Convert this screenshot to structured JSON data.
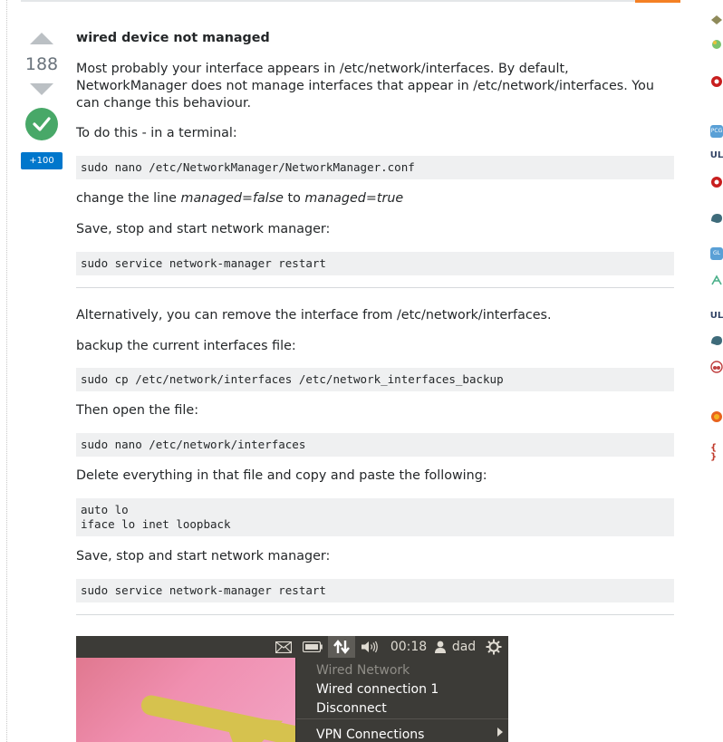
{
  "answer": {
    "vote_count": "188",
    "bounty": "+100",
    "heading": "wired device not managed",
    "p1": "Most probably your interface appears in /etc/network/interfaces. By default, NetworkManager does not manage interfaces that appear in /etc/network/interfaces. You can change this behaviour.",
    "p2": "To do this - in a terminal:",
    "code1": "sudo nano /etc/NetworkManager/NetworkManager.conf",
    "p3_pre": "change the line ",
    "p3_em1": "managed=false",
    "p3_mid": " to ",
    "p3_em2": "managed=true",
    "p4": "Save, stop and start network manager:",
    "code2": "sudo service network-manager restart",
    "p5": "Alternatively, you can remove the interface from /etc/network/interfaces.",
    "p6": "backup the current interfaces file:",
    "code3": "sudo cp /etc/network/interfaces /etc/network_interfaces_backup",
    "p7": "Then open the file:",
    "code4": "sudo nano /etc/network/interfaces",
    "p8": "Delete everything in that file and copy and paste the following:",
    "code5": "auto lo\niface lo inet loopback",
    "p9": "Save, stop and start network manager:",
    "code6": "sudo service network-manager restart"
  },
  "screenshot": {
    "time": "00:18",
    "user": "dad",
    "menu_items": [
      "Wired Network",
      "Wired connection 1",
      "Disconnect",
      "VPN Connections"
    ],
    "icons": [
      "mail-icon",
      "battery-icon",
      "network-icon",
      "volume-icon",
      "user-icon",
      "gear-icon"
    ]
  },
  "sidebar": {
    "icons": [
      "site-icon-1",
      "site-icon-2",
      "site-icon-3",
      "site-icon-4",
      "site-icon-5",
      "site-icon-6",
      "site-icon-7",
      "site-icon-8",
      "site-icon-9",
      "site-icon-10",
      "site-icon-11",
      "site-icon-12",
      "site-icon-13",
      "site-icon-14"
    ],
    "labels": {
      "pcg": "PCG",
      "ul": "UL",
      "gl": "GL",
      "braces": "{ }"
    }
  },
  "colors": {
    "accepted": "#48a868",
    "bounty": "#0077cc",
    "code_bg": "#eff0f1",
    "accent": "#f48024"
  }
}
